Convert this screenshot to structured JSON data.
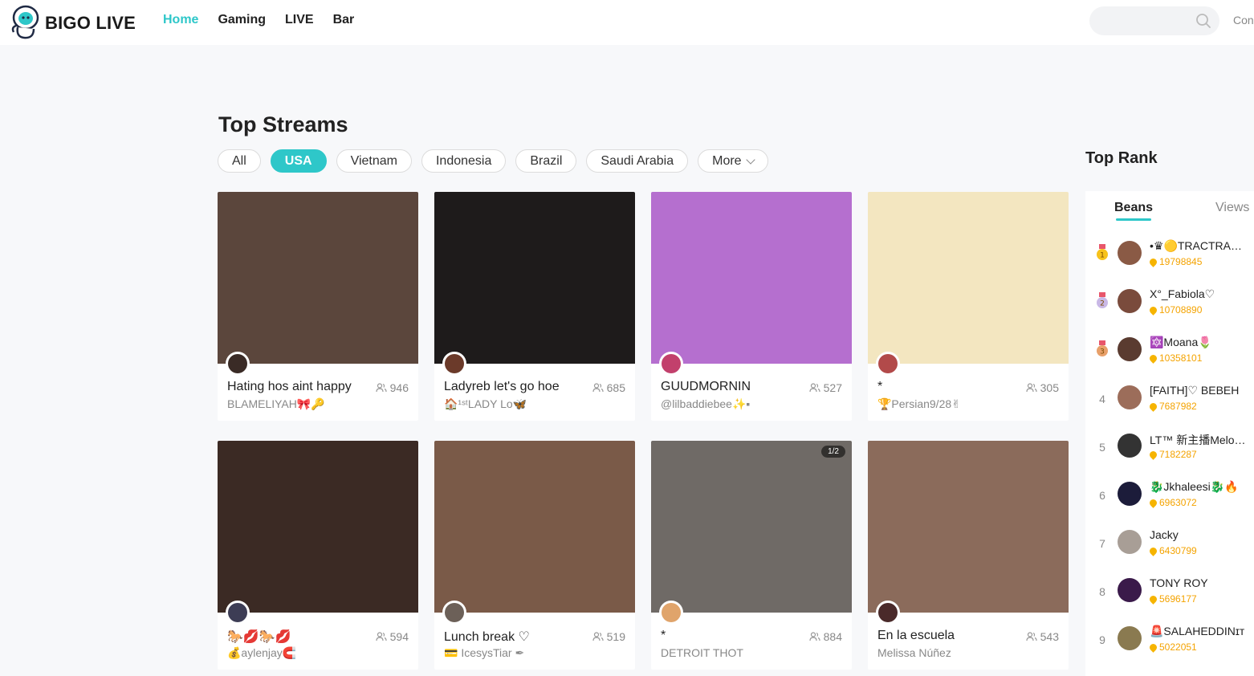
{
  "header": {
    "brand": "BIGO LIVE",
    "nav": [
      {
        "label": "Home",
        "active": true
      },
      {
        "label": "Gaming",
        "active": false
      },
      {
        "label": "LIVE",
        "active": false
      },
      {
        "label": "Bar",
        "active": false
      }
    ],
    "search_placeholder": "",
    "right_text": "Con"
  },
  "main": {
    "title": "Top Streams",
    "filters": [
      {
        "label": "All",
        "active": false
      },
      {
        "label": "USA",
        "active": true
      },
      {
        "label": "Vietnam",
        "active": false
      },
      {
        "label": "Indonesia",
        "active": false
      },
      {
        "label": "Brazil",
        "active": false
      },
      {
        "label": "Saudi Arabia",
        "active": false
      },
      {
        "label": "More",
        "active": false
      }
    ],
    "streams": [
      {
        "title": "Hating hos aint happy",
        "host": "BLAMELIYAH🎀🔑",
        "viewers": "946",
        "thumb_color": "#5b463c",
        "avatar_color": "#3a2b26"
      },
      {
        "title": "Ladyreb let's go hoe",
        "host": "🏠¹ˢᵗLADY Lo🦋",
        "viewers": "685",
        "thumb_color": "#1e1b1b",
        "avatar_color": "#6b3a2a"
      },
      {
        "title": "GUUDMORNIN",
        "host": "@lilbaddiebee✨▪",
        "viewers": "527",
        "thumb_color": "#b56fcf",
        "avatar_color": "#c2406c"
      },
      {
        "title": "*",
        "host": "🏆Persian9/28✌",
        "viewers": "305",
        "thumb_color": "#f3e6c0",
        "avatar_color": "#b24a4a"
      },
      {
        "title": "🐎💋🐎💋",
        "host": "💰aylenjay🧲",
        "viewers": "594",
        "thumb_color": "#3b2a24",
        "avatar_color": "#3d3d55"
      },
      {
        "title": "Lunch break ♡",
        "host": "💳 IcesysTiar ✒",
        "viewers": "519",
        "thumb_color": "#7a5a48",
        "avatar_color": "#6c6058"
      },
      {
        "title": "*",
        "host": "DETROIT THOT",
        "viewers": "884",
        "thumb_color": "#6f6a66",
        "avatar_color": "#e0a46b",
        "page": "1/2"
      },
      {
        "title": "En la escuela",
        "host": "Melissa Núñez",
        "viewers": "543",
        "thumb_color": "#8b6b5b",
        "avatar_color": "#4a2a2a"
      }
    ]
  },
  "rank": {
    "title": "Top Rank",
    "tabs": [
      {
        "label": "Beans",
        "active": true
      },
      {
        "label": "Views",
        "active": false
      }
    ],
    "rows": [
      {
        "pos": "1",
        "name": "•♛🟡TRACTRA…",
        "score": "19798845",
        "medal": "#f7c21b",
        "avatar": "#8a5a45"
      },
      {
        "pos": "2",
        "name": "X°_Fabiola♡",
        "score": "10708890",
        "medal": "#c9b8e6",
        "avatar": "#7a4b3c"
      },
      {
        "pos": "3",
        "name": "🔯Moana🌷",
        "score": "10358101",
        "medal": "#e8a06a",
        "avatar": "#5a3b30"
      },
      {
        "pos": "4",
        "name": "[FAITH]♡ BEBEH",
        "score": "7687982",
        "medal": "",
        "avatar": "#9c6d5a"
      },
      {
        "pos": "5",
        "name": "LT™ 新主播Melo…",
        "score": "7182287",
        "medal": "",
        "avatar": "#333333"
      },
      {
        "pos": "6",
        "name": "🐉Jkhaleesi🐉🔥",
        "score": "6963072",
        "medal": "",
        "avatar": "#1c1c3a"
      },
      {
        "pos": "7",
        "name": "Jacky",
        "score": "6430799",
        "medal": "",
        "avatar": "#a89e96"
      },
      {
        "pos": "8",
        "name": "TONY ROY",
        "score": "5696177",
        "medal": "",
        "avatar": "#3a1a4a"
      },
      {
        "pos": "9",
        "name": "🚨SALAHEDDINɪᴛ",
        "score": "5022051",
        "medal": "",
        "avatar": "#8a7a50"
      }
    ]
  }
}
